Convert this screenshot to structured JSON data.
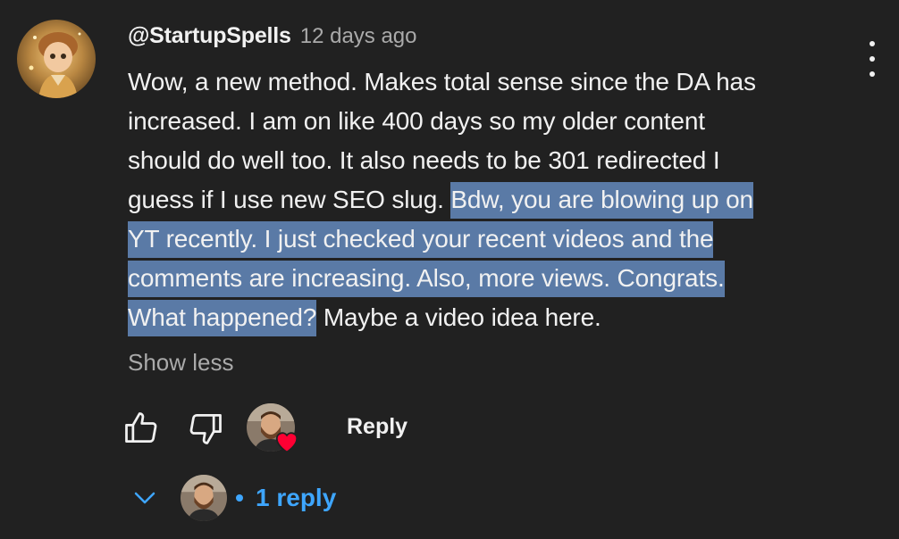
{
  "comment": {
    "author": "@StartupSpells",
    "timestamp": "12 days ago",
    "text_lines": [
      {
        "before": "Wow, a new method. Makes total sense since the DA has",
        "highlight": ""
      },
      {
        "before": "increased. I am on like 400 days so my older content",
        "highlight": ""
      },
      {
        "before": "should do well too. It also needs to be 301 redirected I",
        "highlight": ""
      },
      {
        "before": "guess if I use new SEO slug. ",
        "highlight": "Bdw, you are blowing up on"
      },
      {
        "before": "",
        "highlight": "YT recently. I just checked your recent videos and the"
      },
      {
        "before": "",
        "highlight": "comments are increasing. Also, more views. Congrats."
      },
      {
        "before": "",
        "highlight": "What happened?",
        "after": " Maybe a video idea here."
      }
    ],
    "show_less_label": "Show less"
  },
  "actions": {
    "reply_label": "Reply"
  },
  "replies": {
    "count_label": "1 reply"
  },
  "colors": {
    "background": "#212121",
    "text": "#f1f1f1",
    "secondary_text": "#aaaaaa",
    "highlight": "#5a7aa6",
    "link_blue": "#3ea6ff",
    "heart_red": "#ff0033"
  },
  "icons": {
    "author_avatar": "avatar",
    "menu": "more-vertical-icon",
    "like": "thumbs-up-icon",
    "dislike": "thumbs-down-icon",
    "creator_heart": "heart-icon",
    "expand_replies": "chevron-down-icon"
  }
}
